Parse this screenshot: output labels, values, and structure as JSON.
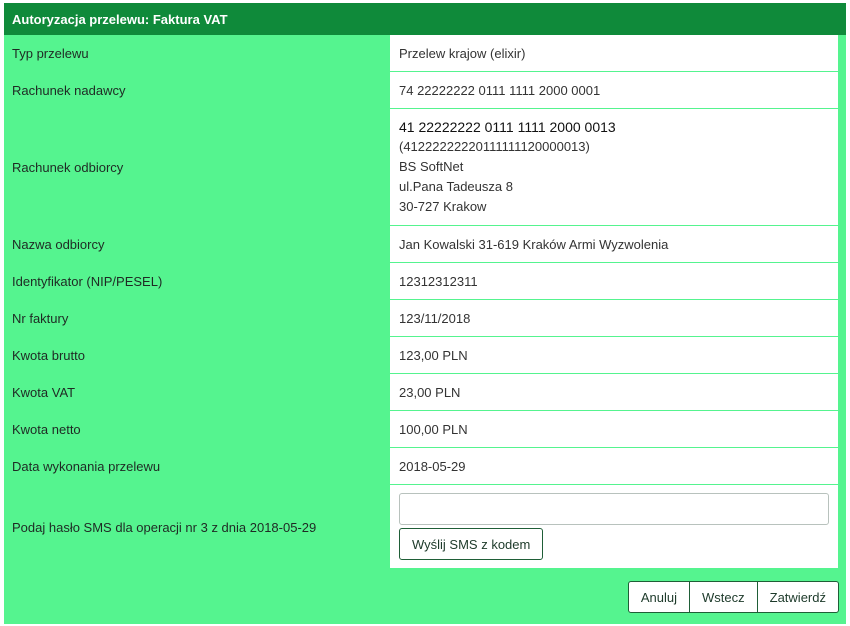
{
  "header": {
    "title": "Autoryzacja przelewu: Faktura VAT"
  },
  "rows": [
    {
      "label": "Typ przelewu",
      "value": "Przelew krajow (elixir)"
    },
    {
      "label": "Rachunek nadawcy",
      "value": "74 22222222 0111 1111 2000 0001"
    },
    {
      "label": "Rachunek odbiorcy",
      "account": "41 22222222 0111 1111 2000 0013",
      "account_raw": "(41222222220111111120000013)",
      "bank": "BS SoftNet",
      "street": "ul.Pana Tadeusza 8",
      "city": "30-727 Krakow"
    },
    {
      "label": "Nazwa odbiorcy",
      "value": "Jan Kowalski 31-619 Kraków Armi Wyzwolenia"
    },
    {
      "label": "Identyfikator (NIP/PESEL)",
      "value": "12312312311"
    },
    {
      "label": "Nr faktury",
      "value": "123/11/2018"
    },
    {
      "label": "Kwota brutto",
      "value": "123,00 PLN"
    },
    {
      "label": "Kwota VAT",
      "value": "23,00 PLN"
    },
    {
      "label": "Kwota netto",
      "value": "100,00 PLN"
    },
    {
      "label": "Data wykonania przelewu",
      "value": "2018-05-29"
    }
  ],
  "sms": {
    "label": "Podaj hasło SMS dla operacji nr 3 z dnia 2018-05-29",
    "input_value": "",
    "send_button": "Wyślij SMS z kodem"
  },
  "actions": {
    "cancel": "Anuluj",
    "back": "Wstecz",
    "confirm": "Zatwierdź"
  },
  "colors": {
    "panel": "#55f48f",
    "header": "#0f8a3a",
    "value_bg": "#ffffff"
  }
}
